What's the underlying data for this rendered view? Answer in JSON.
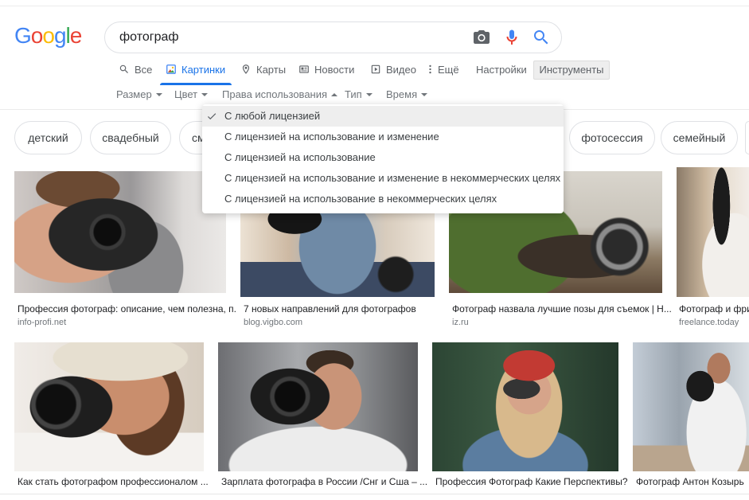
{
  "logo": {
    "letters": [
      "G",
      "o",
      "o",
      "g",
      "l",
      "e"
    ],
    "colors": [
      "#4285f4",
      "#ea4335",
      "#fbbc05",
      "#4285f4",
      "#34a853",
      "#ea4335"
    ]
  },
  "search": {
    "query": "фотограф",
    "camera_icon": "camera-icon",
    "mic_icon": "mic-icon",
    "submit_icon": "search-icon"
  },
  "tabs": [
    {
      "label": "Все",
      "icon": "search-icon",
      "active": false
    },
    {
      "label": "Картинки",
      "icon": "image-icon",
      "active": true
    },
    {
      "label": "Карты",
      "icon": "map-pin-icon",
      "active": false
    },
    {
      "label": "Новости",
      "icon": "news-icon",
      "active": false
    },
    {
      "label": "Видео",
      "icon": "video-icon",
      "active": false
    },
    {
      "label": "Ещё",
      "icon": "more-vert-icon",
      "active": false
    }
  ],
  "settings": {
    "label": "Настройки"
  },
  "tools": {
    "label": "Инструменты",
    "pressed": true
  },
  "filters": [
    {
      "label": "Размер",
      "icon": "caret-down-icon"
    },
    {
      "label": "Цвет",
      "icon": "caret-down-icon"
    },
    {
      "label": "Права использования",
      "icon": "caret-up-icon",
      "open": true
    },
    {
      "label": "Тип",
      "icon": "caret-down-icon"
    },
    {
      "label": "Время",
      "icon": "caret-down-icon"
    }
  ],
  "chips": [
    "детский",
    "свадебный",
    "см",
    "фотосессия",
    "семейный"
  ],
  "license_menu": {
    "items": [
      {
        "label": "С любой лицензией",
        "selected": true,
        "icon": "check-icon"
      },
      {
        "label": "С лицензией на использование и изменение",
        "selected": false
      },
      {
        "label": "С лицензией на использование",
        "selected": false
      },
      {
        "label": "С лицензией на использование и изменение в некоммерческих целях",
        "selected": false
      },
      {
        "label": "С лицензией на использование в некоммерческих целях",
        "selected": false
      }
    ]
  },
  "results": [
    {
      "title": "Профессия фотограф: описание, чем полезна, п...",
      "source": "info-profi.net"
    },
    {
      "title": "7 новых направлений для фотографов",
      "source": "blog.vigbo.com"
    },
    {
      "title": "Фотограф назвала лучшие позы для съемок | Н...",
      "source": "iz.ru"
    },
    {
      "title": "Фотограф и фрил",
      "source": "freelance.today"
    },
    {
      "title": "Как стать фотографом профессионалом ..."
    },
    {
      "title": "Зарплата фотографа в России /Снг и Сша – ..."
    },
    {
      "title": "Профессия Фотограф Какие Перспективы?"
    },
    {
      "title": "Фотограф Антон Козырь"
    }
  ],
  "colors": {
    "accent": "#1a73e8",
    "text": "#202124",
    "secondary_text": "#5f6368",
    "muted_text": "#70757a",
    "border": "#dfe1e5",
    "menu_highlight": "#eeeeee"
  }
}
